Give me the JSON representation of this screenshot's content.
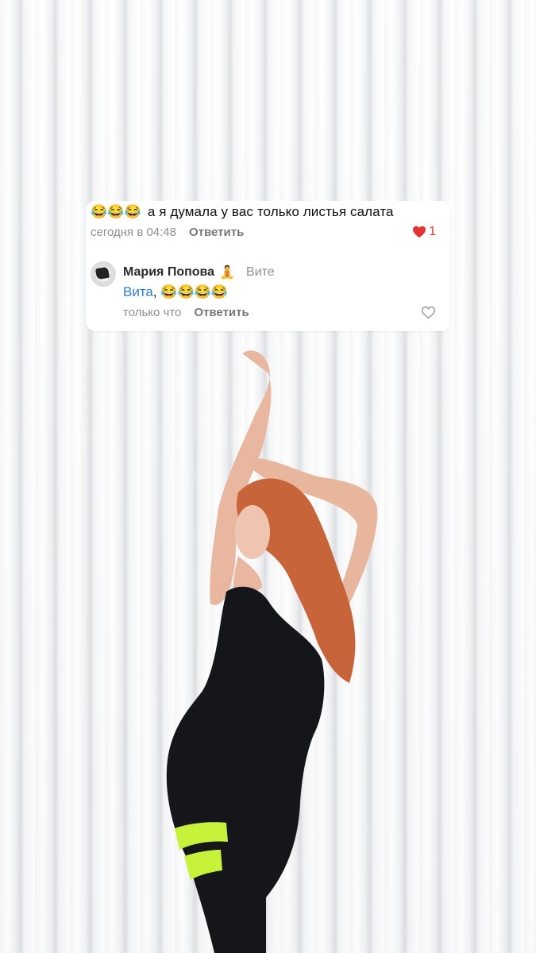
{
  "comment1": {
    "emojis": "😂😂😂",
    "text": "а я думала у вас только листья салата",
    "time": "сегодня в 04:48",
    "reply_label": "Ответить",
    "likes": "1"
  },
  "comment2": {
    "author": "Мария Попова",
    "author_emoji": "🧘",
    "to": "Вите",
    "mention": "Вита",
    "text_suffix": ", 😂😂😂😂",
    "time": "только что",
    "reply_label": "Ответить"
  },
  "icons": {
    "like_filled": "heart-icon",
    "like_outline": "heart-outline-icon"
  },
  "colors": {
    "like_red": "#e33333",
    "mention_blue": "#2a7fd4",
    "meta_gray": "#8a8f96"
  }
}
